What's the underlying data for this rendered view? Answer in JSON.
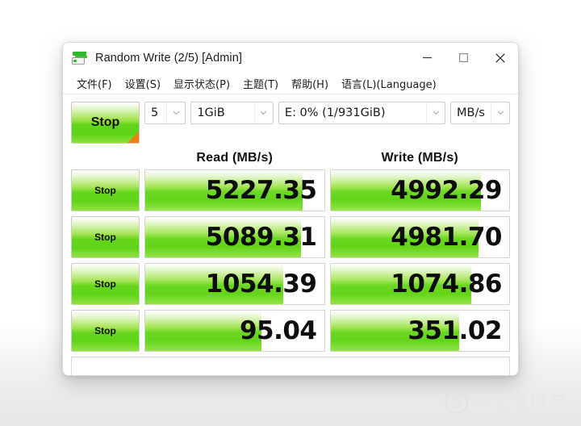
{
  "window": {
    "title": "Random Write (2/5) [Admin]",
    "app_icon": "disk-drive-icon",
    "controls": {
      "minimize": "minimize-icon",
      "maximize": "maximize-icon",
      "close": "close-icon"
    }
  },
  "menu": {
    "items": [
      {
        "label": "文件(F)"
      },
      {
        "label": "设置(S)"
      },
      {
        "label": "显示状态(P)"
      },
      {
        "label": "主题(T)"
      },
      {
        "label": "帮助(H)"
      },
      {
        "label": "语言(L)(Language)"
      }
    ]
  },
  "toolbar": {
    "main_button_label": "Stop",
    "test_count": "5",
    "test_size": "1GiB",
    "target_drive": "E: 0% (1/931GiB)",
    "unit": "MB/s"
  },
  "headers": {
    "read": "Read (MB/s)",
    "write": "Write (MB/s)"
  },
  "rows": [
    {
      "button_label": "Stop",
      "read_value": "5227.35",
      "write_value": "4992.29",
      "read_fill_pct": 88,
      "write_fill_pct": 84
    },
    {
      "button_label": "Stop",
      "read_value": "5089.31",
      "write_value": "4981.70",
      "read_fill_pct": 87,
      "write_fill_pct": 83
    },
    {
      "button_label": "Stop",
      "read_value": "1054.39",
      "write_value": "1074.86",
      "read_fill_pct": 77,
      "write_fill_pct": 79
    },
    {
      "button_label": "Stop",
      "read_value": "95.04",
      "write_value": "351.02",
      "read_fill_pct": 65,
      "write_fill_pct": 72
    }
  ],
  "status": {
    "text": ""
  },
  "watermark": {
    "badge": "值",
    "text": "什么值得买"
  },
  "colors": {
    "accent_green": "#63d41a",
    "corner_orange": "#f07b18",
    "window_bg": "#ffffff",
    "watermark_gray": "#e6e6e6"
  }
}
